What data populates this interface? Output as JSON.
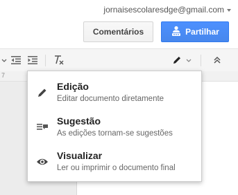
{
  "header": {
    "account_email": "jornaisescolaresdge@gmail.com",
    "comments_label": "Comentários",
    "share_label": "Partilhar"
  },
  "ruler": {
    "marker": "7"
  },
  "mode_menu": {
    "items": [
      {
        "title": "Edição",
        "description": "Editar documento diretamente",
        "icon": "pencil-icon"
      },
      {
        "title": "Sugestão",
        "description": "As edições tornam-se sugestões",
        "icon": "suggest-icon"
      },
      {
        "title": "Visualizar",
        "description": "Ler ou imprimir o documento final",
        "icon": "eye-icon"
      }
    ]
  },
  "colors": {
    "share_blue": "#4d90fe",
    "toolbar_bg": "#f5f5f5"
  }
}
